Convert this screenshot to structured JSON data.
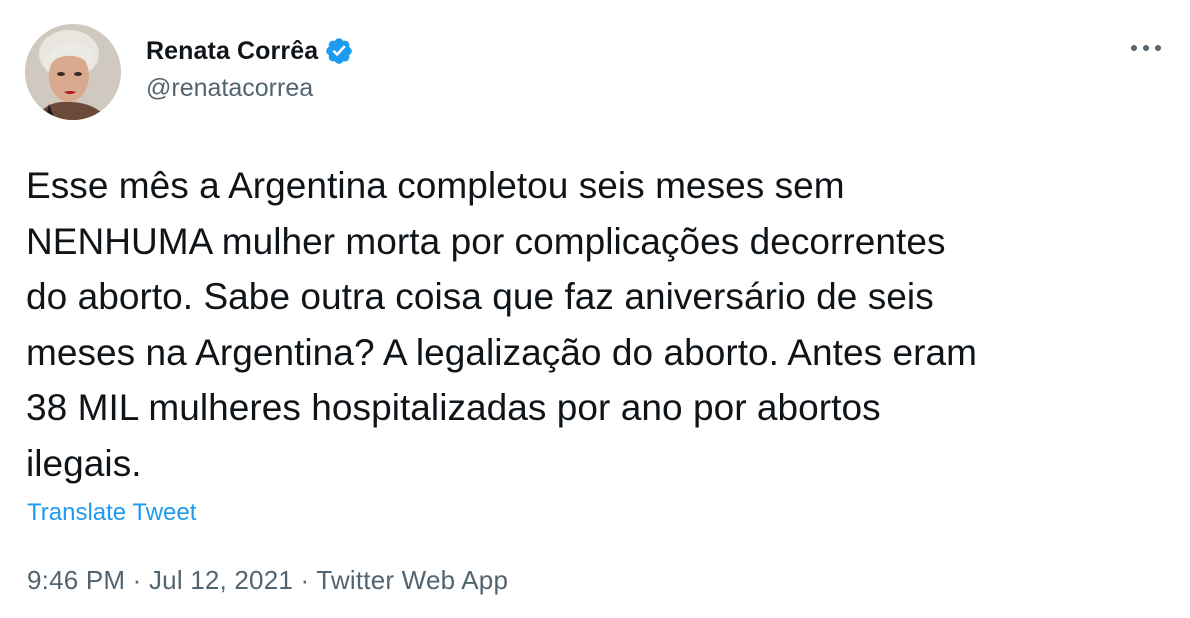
{
  "tweet": {
    "author": {
      "display_name": "Renata Corrêa",
      "handle": "@renatacorrea",
      "verified": true
    },
    "text": "Esse mês a Argentina completou seis meses sem\nNENHUMA mulher morta por complicações decorrentes\ndo aborto. Sabe outra coisa que faz aniversário de seis\nmeses na Argentina? A legalização do aborto. Antes eram\n38 MIL mulheres hospitalizadas por ano por abortos\nilegais.",
    "translate_label": "Translate Tweet",
    "time": "9:46 PM",
    "date": "Jul 12, 2021",
    "source": "Twitter Web App",
    "separator": " · "
  },
  "colors": {
    "text": "#0f1419",
    "secondary": "#536471",
    "accent": "#1d9bf0"
  },
  "icons": {
    "verified": "verified-badge-icon",
    "more": "more-options-icon"
  }
}
